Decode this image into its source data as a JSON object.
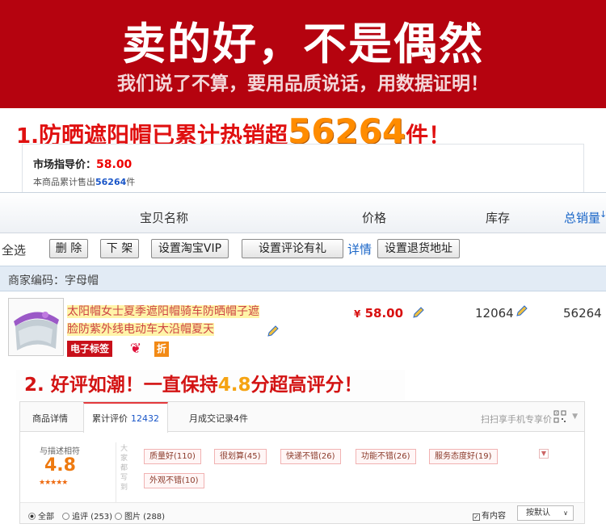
{
  "banner": {
    "title": "卖的好，不是偶然",
    "subtitle": "我们说了不算，要用品质说话，用数据证明！"
  },
  "headline1": {
    "prefix_num": "1.",
    "text": "防晒遮阳帽已累计热销超",
    "highlight": "56264",
    "suffix": "件！"
  },
  "price_box": {
    "guide_label": "市场指导价：",
    "guide_value": "58.00",
    "sold_prefix": "本商品累计售出",
    "sold_count": "56264",
    "sold_suffix": "件"
  },
  "table": {
    "headers": {
      "name": "宝贝名称",
      "price": "价格",
      "stock": "库存",
      "total": "总销量"
    },
    "select_all": "全选",
    "buttons": {
      "delete": "删 除",
      "offshelf": "下 架",
      "vip": "设置淘宝VIP",
      "review_gift": "设置评论有礼",
      "detail": "详情",
      "return_addr": "设置退货地址"
    },
    "merchant_code": "商家编码：字母帽",
    "product": {
      "title_line1": "太阳帽女士夏季遮阳帽骑车防晒帽子遮",
      "title_line2": "脸防紫外线电动车大沿帽夏天",
      "tag_e_label": "电子标签",
      "tag_discount": "折",
      "currency": "¥",
      "price": "58.00",
      "stock": "12064",
      "total": "56264"
    }
  },
  "headline2": {
    "prefix": "2. 好评如潮！一直保持",
    "highlight": "4.8",
    "suffix": "分超高评分！"
  },
  "review": {
    "tabs": [
      {
        "label": "商品详情"
      },
      {
        "label": "累计评价",
        "count": "12432"
      },
      {
        "label": "月成交记录",
        "count": "4件"
      }
    ],
    "scan_text": "扫扫享手机专享价",
    "score_label": "与描述相符",
    "score": "4.8",
    "stars": "★★★★★",
    "vertical_text": "大家都写到",
    "tags": [
      "质量好(110)",
      "很划算(45)",
      "快递不错(26)",
      "功能不错(26)",
      "服务态度好(19)",
      "外观不错(10)"
    ],
    "filters": {
      "all": "全部",
      "append": "追评 (253)",
      "pics": "图片 (288)"
    },
    "has_content": "有内容",
    "sort_label": "按默认"
  },
  "colors": {
    "banner_red": "#b5030f",
    "accent_orange": "#ff8c00",
    "link_blue": "#1a66c8"
  }
}
